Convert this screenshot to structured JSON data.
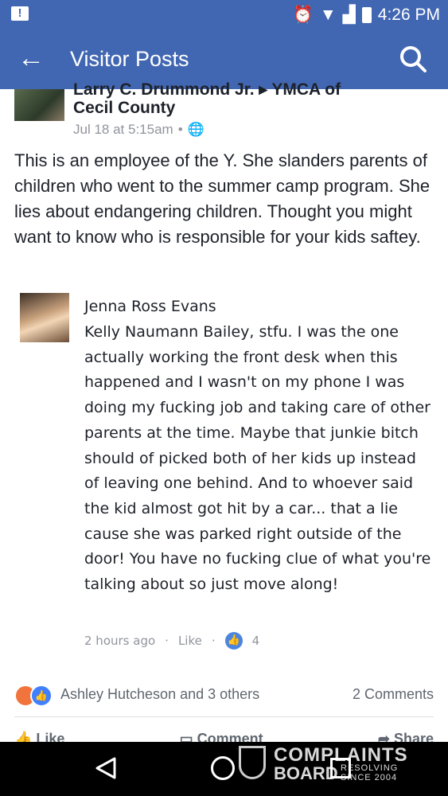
{
  "status_bar": {
    "time": "4:26 PM"
  },
  "app_bar": {
    "title": "Visitor Posts"
  },
  "post": {
    "author_top_partial": "Larry C. Drummond Jr. ▸ YMCA of",
    "author": "Cecil County",
    "timestamp": "Jul 18 at 5:15am",
    "text": "This is an employee of the Y. She slanders parents of children who went to the summer camp program. She lies about endangering children. Thought you might want to know who is responsible for your kids saftey."
  },
  "screenshot_comment": {
    "author": "Jenna Ross Evans",
    "body": "Kelly Naumann Bailey, stfu. I was the one actually working the front desk when this happened and I wasn't on my phone I was doing my fucking job and taking care of other parents at the time. Maybe that junkie bitch should of picked both of her kids up instead of leaving one behind. And to whoever said the kid almost got hit by a car... that a lie cause she was parked right outside of the door! You have no fucking clue of what you're talking about so just move along!",
    "time": "2 hours ago",
    "like_label": "Like",
    "like_count": "4"
  },
  "reactions": {
    "names": "Ashley Hutcheson and 3 others",
    "comments": "2 Comments"
  },
  "actions": {
    "like": "Like",
    "comment": "Comment",
    "share": "Share"
  },
  "watermark": {
    "line1": "COMPLAINTS",
    "line2": "BOARD",
    "line3": "RESOLVING SINCE 2004"
  }
}
